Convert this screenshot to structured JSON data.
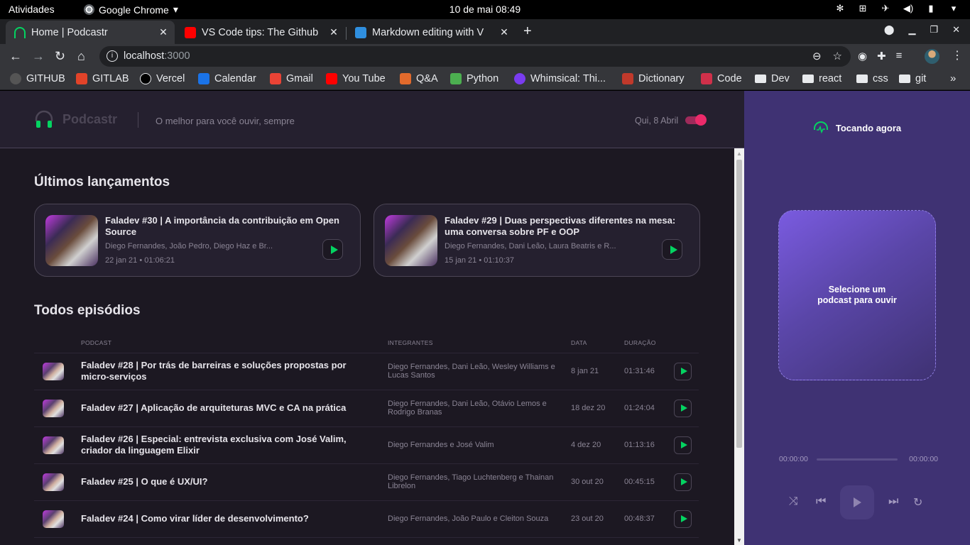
{
  "topbar": {
    "activities": "Atividades",
    "app": "Google Chrome",
    "clock": "10 de mai  08:49"
  },
  "tabs": [
    {
      "title": "Home | Podcastr",
      "favicon_color": "#04d361"
    },
    {
      "title": "VS Code tips: The Github",
      "favicon_color": "#ff0000"
    },
    {
      "title": "Markdown editing with V",
      "favicon_color": "#2f8fdf"
    }
  ],
  "address": {
    "host": "localhost",
    "port": ":3000"
  },
  "bookmarks": [
    {
      "label": "GITHUB",
      "icon": "github-icon",
      "color": "#555"
    },
    {
      "label": "GITLAB",
      "icon": "gitlab-icon",
      "color": "#e24329"
    },
    {
      "label": "Vercel",
      "icon": "vercel-icon",
      "color": "#000"
    },
    {
      "label": "Calendar",
      "icon": "calendar-icon",
      "color": "#1a73e8"
    },
    {
      "label": "Gmail",
      "icon": "gmail-icon",
      "color": "#ea4335"
    },
    {
      "label": "You Tube",
      "icon": "youtube-icon",
      "color": "#ff0000"
    },
    {
      "label": "Q&A",
      "icon": "qa-icon",
      "color": "#e26a2c"
    },
    {
      "label": "Python",
      "icon": "python-icon",
      "color": "#4caf50"
    },
    {
      "label": "Whimsical: Thi...",
      "icon": "whimsical-icon",
      "color": "#7a3cf0"
    },
    {
      "label": "Dictionary",
      "icon": "dictionary-icon",
      "color": "#c0392b"
    },
    {
      "label": "Code",
      "icon": "code-icon",
      "color": "#d0304a"
    },
    {
      "label": "Dev",
      "icon": "folder-icon",
      "color": "#e8eaed"
    },
    {
      "label": "react",
      "icon": "folder-icon",
      "color": "#e8eaed"
    },
    {
      "label": "css",
      "icon": "folder-icon",
      "color": "#e8eaed"
    },
    {
      "label": "git",
      "icon": "folder-icon",
      "color": "#e8eaed"
    }
  ],
  "header": {
    "brand": "Podcastr",
    "tagline": "O melhor para você ouvir, sempre",
    "date": "Qui, 8 Abril"
  },
  "latest": {
    "heading": "Últimos lançamentos",
    "episodes": [
      {
        "title": "Faladev #30 | A importância da contribuição em Open Source",
        "members": "Diego Fernandes, João Pedro, Diego Haz e Br...",
        "meta": "22 jan 21 • 01:06:21"
      },
      {
        "title": "Faladev #29 | Duas perspectivas diferentes na mesa: uma conversa sobre PF e OOP",
        "members": "Diego Fernandes, Dani Leão, Laura Beatris e R...",
        "meta": "15 jan 21 • 01:10:37"
      }
    ]
  },
  "all": {
    "heading": "Todos episódios",
    "columns": {
      "podcast": "PODCAST",
      "members": "INTEGRANTES",
      "date": "DATA",
      "duration": "DURAÇÃO"
    },
    "rows": [
      {
        "title": "Faladev #28 | Por trás de barreiras e soluções propostas por micro-serviços",
        "members": "Diego Fernandes, Dani Leão, Wesley Williams e Lucas Santos",
        "date": "8 jan 21",
        "duration": "01:31:46"
      },
      {
        "title": "Faladev #27 | Aplicação de arquiteturas MVC e CA na prática",
        "members": "Diego Fernandes, Dani Leão, Otávio Lemos e Rodrigo Branas",
        "date": "18 dez 20",
        "duration": "01:24:04"
      },
      {
        "title": "Faladev #26 | Especial: entrevista exclusiva com José Valim, criador da linguagem Elixir",
        "members": "Diego Fernandes e José Valim",
        "date": "4 dez 20",
        "duration": "01:13:16"
      },
      {
        "title": "Faladev #25 | O que é UX/UI?",
        "members": "Diego Fernandes, Tiago Luchtenberg e Thainan Librelon",
        "date": "30 out 20",
        "duration": "00:45:15"
      },
      {
        "title": "Faladev #24 | Como virar líder de desenvolvimento?",
        "members": "Diego Fernandes, João Paulo e Cleiton Souza",
        "date": "23 out 20",
        "duration": "00:48:37"
      }
    ]
  },
  "player": {
    "now_playing": "Tocando agora",
    "empty": "Selecione um podcast para ouvir",
    "current": "00:00:00",
    "total": "00:00:00"
  }
}
